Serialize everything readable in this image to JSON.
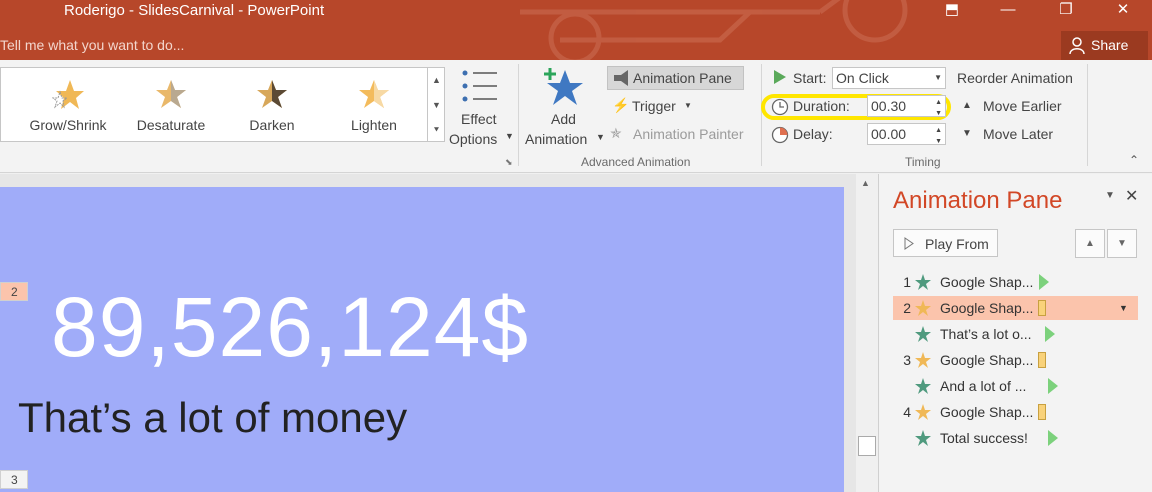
{
  "titlebar": {
    "title": "Roderigo - SlidesCarnival - PowerPoint",
    "tell_me": "Tell me what you want to do...",
    "share": "Share",
    "controls": {
      "restore_ribbon": "⬒",
      "minimize": "—",
      "maximize": "❐",
      "close": "✕"
    }
  },
  "ribbon": {
    "gallery": {
      "items": [
        {
          "label": "Grow/Shrink",
          "icon": "grow-shrink-star-icon"
        },
        {
          "label": "Desaturate",
          "icon": "desaturate-star-icon"
        },
        {
          "label": "Darken",
          "icon": "darken-star-icon"
        },
        {
          "label": "Lighten",
          "icon": "lighten-star-icon"
        }
      ]
    },
    "effect_options": {
      "line1": "Effect",
      "line2": "Options"
    },
    "add_animation": {
      "line1": "Add",
      "line2": "Animation"
    },
    "animation_pane_button": "Animation Pane",
    "trigger": "Trigger",
    "animation_painter": "Animation Painter",
    "group_advanced": "Advanced Animation",
    "start_label": "Start:",
    "start_value": "On Click",
    "duration_label": "Duration:",
    "duration_value": "00.30",
    "delay_label": "Delay:",
    "delay_value": "00.00",
    "group_timing": "Timing",
    "reorder_title": "Reorder Animation",
    "move_earlier": "Move Earlier",
    "move_later": "Move Later"
  },
  "slide": {
    "big_number": "89,526,124$",
    "subtitle": "That’s a lot of money",
    "prev_slide_num": "2",
    "next_slide_num": "3",
    "bg_color": "#a0acf9"
  },
  "pane": {
    "title": "Animation Pane",
    "play_from": "Play From",
    "items": [
      {
        "num": "1",
        "text": "Google Shap...",
        "kind": "entrance"
      },
      {
        "num": "2",
        "text": "Google Shap...",
        "kind": "emphasis",
        "selected": true
      },
      {
        "num": "",
        "text": "That’s a lot o...",
        "kind": "entrance"
      },
      {
        "num": "3",
        "text": "Google Shap...",
        "kind": "emphasis"
      },
      {
        "num": "",
        "text": "And a lot of ...",
        "kind": "entrance"
      },
      {
        "num": "4",
        "text": "Google Shap...",
        "kind": "emphasis"
      },
      {
        "num": "",
        "text": "Total success!",
        "kind": "entrance"
      }
    ]
  },
  "colors": {
    "titlebar": "#b7472a",
    "accent_orange": "#d24726",
    "highlight_yellow": "#ffe600",
    "selected_row": "#fbc4ac"
  }
}
